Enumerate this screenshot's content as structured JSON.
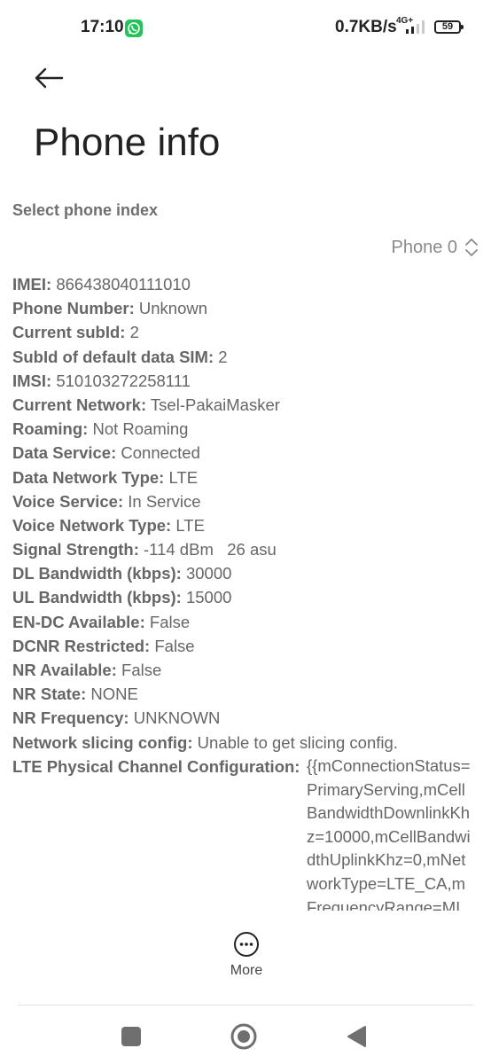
{
  "status_bar": {
    "time": "17:10",
    "speed": "0.7KB/s",
    "network_type": "4G+",
    "battery": "59",
    "icons": [
      "whatsapp-icon",
      "signal-icon",
      "battery-icon"
    ]
  },
  "header": {
    "title": "Phone info",
    "back_icon": "arrow-left-icon"
  },
  "selector": {
    "label": "Select phone index",
    "value": "Phone 0",
    "icon": "chevron-updown-icon"
  },
  "info": [
    {
      "key": "IMEI:",
      "value": "866438040111010"
    },
    {
      "key": "Phone Number:",
      "value": "Unknown"
    },
    {
      "key": "Current subId:",
      "value": "2"
    },
    {
      "key": "SubId of default data SIM:",
      "value": "2"
    },
    {
      "key": "IMSI:",
      "value": "510103272258111"
    },
    {
      "key": "Current Network:",
      "value": "Tsel-PakaiMasker"
    },
    {
      "key": "Roaming:",
      "value": "Not Roaming"
    },
    {
      "key": "Data Service:",
      "value": "Connected"
    },
    {
      "key": "Data Network Type:",
      "value": "LTE"
    },
    {
      "key": "Voice Service:",
      "value": "In Service"
    },
    {
      "key": "Voice Network Type:",
      "value": "LTE"
    },
    {
      "key": "Signal Strength:",
      "value": "-114 dBm   26 asu"
    },
    {
      "key": "DL Bandwidth (kbps):",
      "value": "30000"
    },
    {
      "key": "UL Bandwidth (kbps):",
      "value": "15000"
    },
    {
      "key": "EN-DC Available:",
      "value": "False"
    },
    {
      "key": "DCNR Restricted:",
      "value": "False"
    },
    {
      "key": "NR Available:",
      "value": "False"
    },
    {
      "key": "NR State:",
      "value": "NONE"
    },
    {
      "key": "NR Frequency:",
      "value": "UNKNOWN"
    },
    {
      "key": "Network slicing config:",
      "value": "Unable to get slicing config."
    }
  ],
  "lte_config": {
    "key": "LTE Physical Channel Configuration:",
    "value": "{{mConnectionStatus=PrimaryServing,mCellBandwidthDownlinkKhz=10000,mCellBandwidthUplinkKhz=0,mNetworkType=LTE_CA,mFrequencyRange=MID,mDo"
  },
  "bottom": {
    "more_label": "More",
    "more_icon": "more-horizontal-icon"
  },
  "nav": {
    "recent_icon": "square-icon",
    "home_icon": "circle-icon",
    "back_icon": "triangle-back-icon"
  }
}
